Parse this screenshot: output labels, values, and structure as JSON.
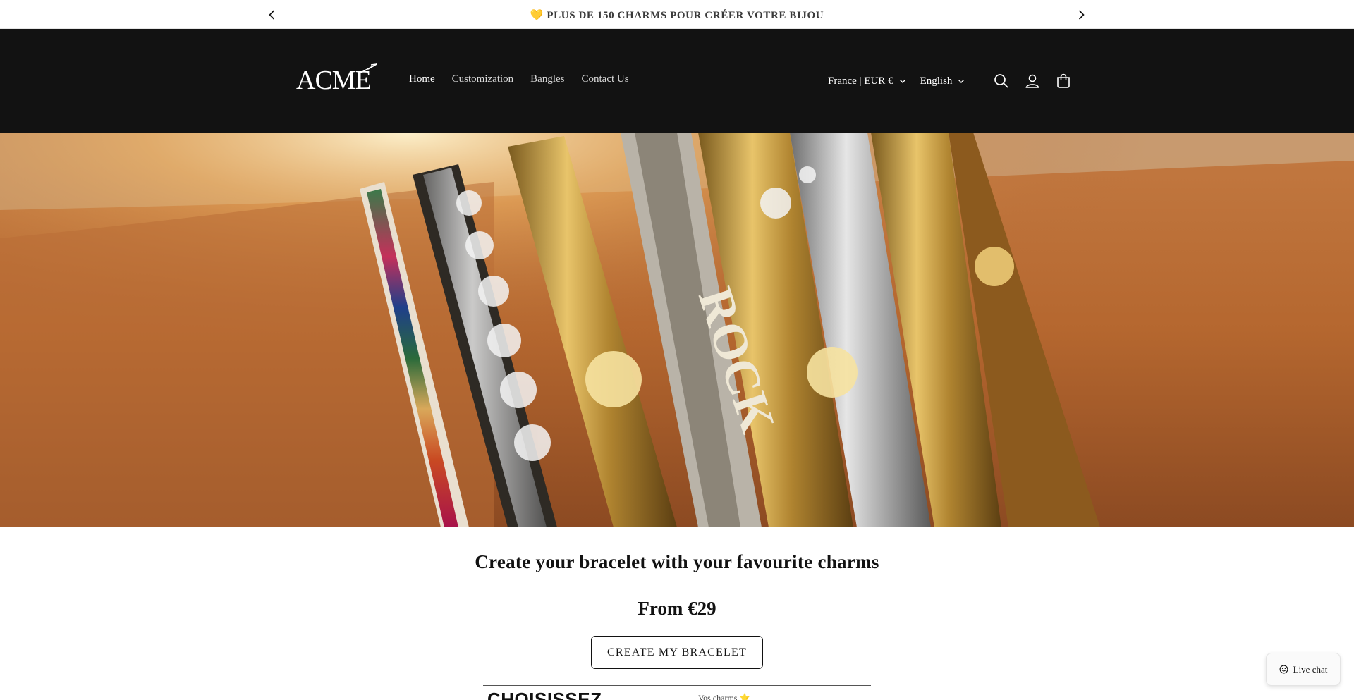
{
  "announcement": {
    "emoji": "💛",
    "text": "PLUS DE 150 CHARMS POUR CRÉER VOTRE BIJOU"
  },
  "header": {
    "logo_text": "ACME",
    "nav": [
      {
        "label": "Home",
        "active": true
      },
      {
        "label": "Customization",
        "active": false
      },
      {
        "label": "Bangles",
        "active": false
      },
      {
        "label": "Contact Us",
        "active": false
      }
    ],
    "country_selector": "France | EUR €",
    "language_selector": "English",
    "icons": [
      "search-icon",
      "account-icon",
      "cart-icon"
    ]
  },
  "hero": {
    "image_description_icon": "bangles-photo",
    "bangle_lettering": "ROCK"
  },
  "main": {
    "headline": "Create your bracelet with your favourite charms",
    "price": "From €29",
    "cta_label": "CREATE MY BRACELET"
  },
  "teaser": {
    "big_text": "CHOISISSEZ",
    "small_text": "Vos charms ⭐"
  },
  "chat": {
    "label": "Live chat"
  },
  "colors": {
    "header_bg": "#121212",
    "text": "#121212",
    "background": "#ffffff"
  }
}
